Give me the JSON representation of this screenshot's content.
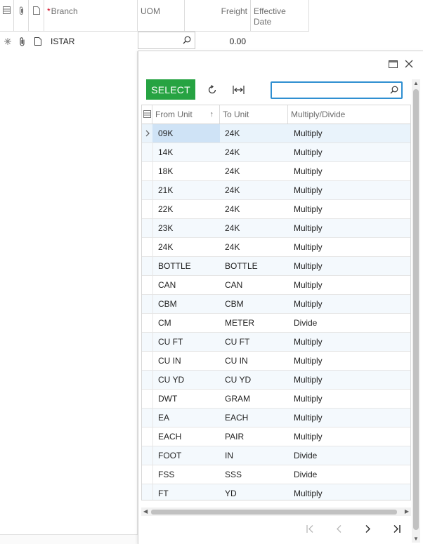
{
  "grid": {
    "columns": {
      "branch": "Branch",
      "uom": "UOM",
      "freight": "Freight",
      "effective_date_line1": "Effective",
      "effective_date_line2": "Date"
    },
    "new_row": {
      "branch_value": "ISTAR",
      "uom_value": "",
      "freight_value": "0.00"
    }
  },
  "popup": {
    "select_label": "SELECT",
    "search_placeholder": "",
    "columns": {
      "from_unit": "From Unit",
      "to_unit": "To Unit",
      "multiply_divide": "Multiply/Divide"
    },
    "sort_indicator": "↑",
    "rows": [
      {
        "from": "09K",
        "to": "24K",
        "op": "Multiply"
      },
      {
        "from": "14K",
        "to": "24K",
        "op": "Multiply"
      },
      {
        "from": "18K",
        "to": "24K",
        "op": "Multiply"
      },
      {
        "from": "21K",
        "to": "24K",
        "op": "Multiply"
      },
      {
        "from": "22K",
        "to": "24K",
        "op": "Multiply"
      },
      {
        "from": "23K",
        "to": "24K",
        "op": "Multiply"
      },
      {
        "from": "24K",
        "to": "24K",
        "op": "Multiply"
      },
      {
        "from": "BOTTLE",
        "to": "BOTTLE",
        "op": "Multiply"
      },
      {
        "from": "CAN",
        "to": "CAN",
        "op": "Multiply"
      },
      {
        "from": "CBM",
        "to": "CBM",
        "op": "Multiply"
      },
      {
        "from": "CM",
        "to": "METER",
        "op": "Divide"
      },
      {
        "from": "CU FT",
        "to": "CU FT",
        "op": "Multiply"
      },
      {
        "from": "CU IN",
        "to": "CU IN",
        "op": "Multiply"
      },
      {
        "from": "CU YD",
        "to": "CU YD",
        "op": "Multiply"
      },
      {
        "from": "DWT",
        "to": "GRAM",
        "op": "Multiply"
      },
      {
        "from": "EA",
        "to": "EACH",
        "op": "Multiply"
      },
      {
        "from": "EACH",
        "to": "PAIR",
        "op": "Multiply"
      },
      {
        "from": "FOOT",
        "to": "IN",
        "op": "Divide"
      },
      {
        "from": "FSS",
        "to": "SSS",
        "op": "Divide"
      },
      {
        "from": "FT",
        "to": "YD",
        "op": "Multiply"
      }
    ]
  },
  "icons": {
    "row_selector": "grid-settings-icon",
    "attachment": "paperclip-icon",
    "note": "document-icon",
    "new_row_marker": "asterisk-icon",
    "lookup": "magnifier-icon",
    "maximize": "maximize-icon",
    "close": "close-icon",
    "refresh": "refresh-icon",
    "fit_columns": "fit-columns-icon",
    "pager_first": "first-page-icon",
    "pager_prev": "previous-page-icon",
    "pager_next": "next-page-icon",
    "pager_last": "last-page-icon"
  },
  "colors": {
    "select_button": "#26a342",
    "search_focus_border": "#2f8fd1",
    "selected_cell": "#cfe3f6",
    "alt_row": "#f4f9fd",
    "required_star": "#d0021b"
  }
}
